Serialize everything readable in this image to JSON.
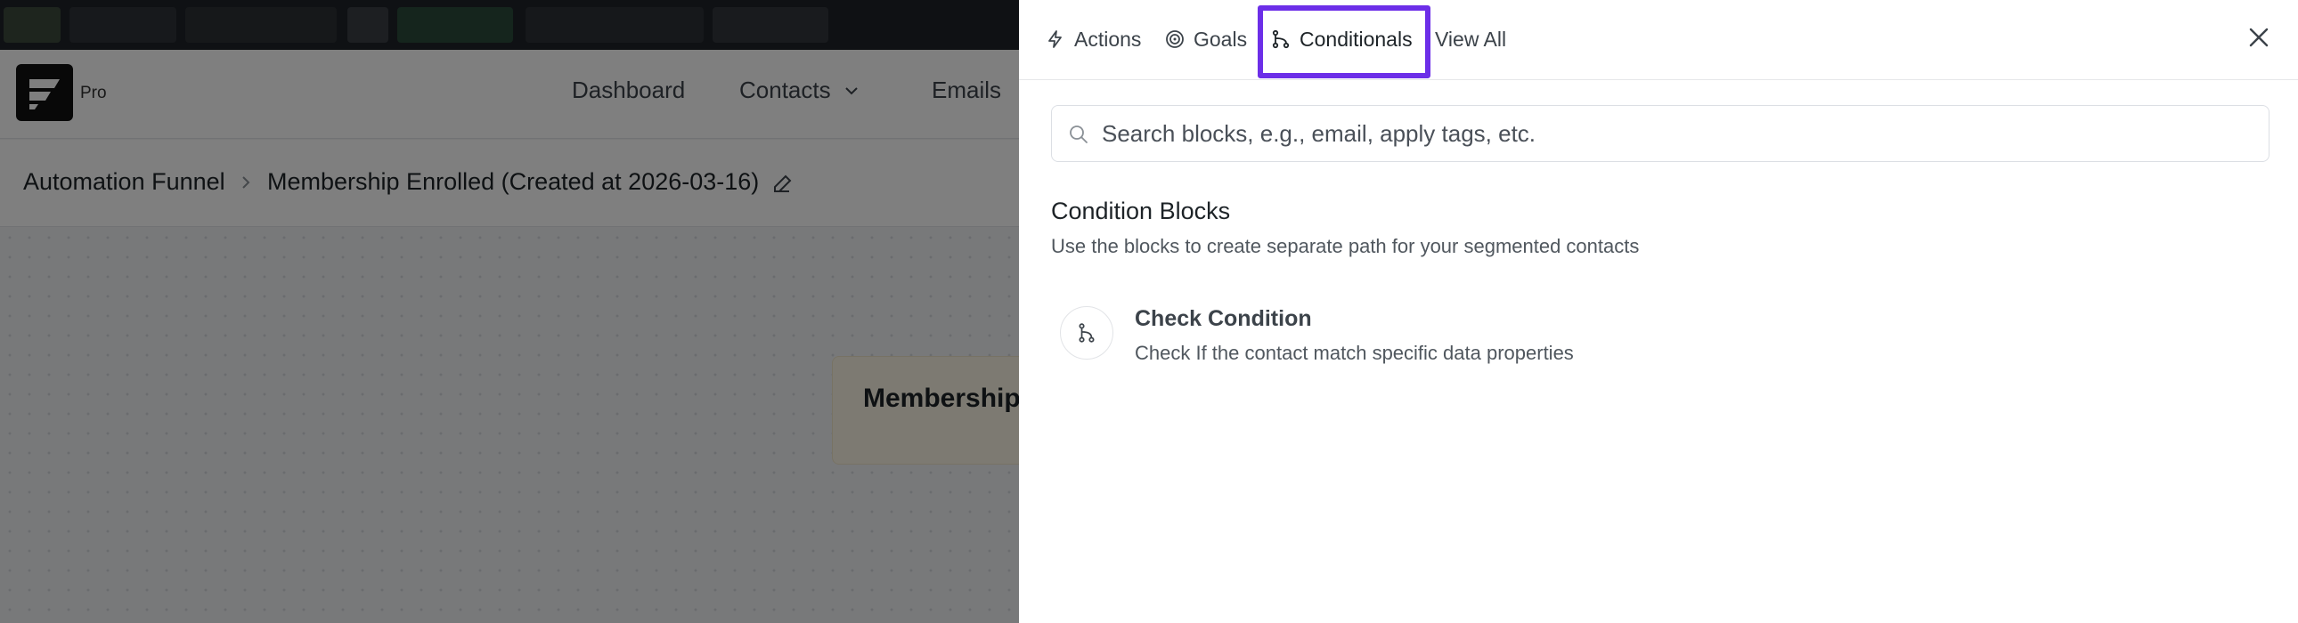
{
  "app": {
    "badge": "Pro",
    "nav": [
      {
        "label": "Dashboard"
      },
      {
        "label": "Contacts"
      },
      {
        "label": "Emails"
      }
    ],
    "breadcrumb": {
      "root": "Automation Funnel",
      "current": "Membership Enrolled (Created at 2026-03-16)"
    },
    "trigger_card_title": "Membership"
  },
  "drawer": {
    "tabs": [
      {
        "label": "Actions",
        "icon": "lightning-icon"
      },
      {
        "label": "Goals",
        "icon": "target-icon"
      },
      {
        "label": "Conditionals",
        "icon": "branch-icon",
        "active": true
      },
      {
        "label": "View All"
      }
    ],
    "highlight_color": "#6c2ee8",
    "search": {
      "placeholder": "Search blocks, e.g., email, apply tags, etc.",
      "value": ""
    },
    "section": {
      "title": "Condition Blocks",
      "description": "Use the blocks to create separate path for your segmented contacts"
    },
    "blocks": [
      {
        "title": "Check Condition",
        "description": "Check If the contact match specific data properties",
        "icon": "branch-icon"
      }
    ]
  }
}
